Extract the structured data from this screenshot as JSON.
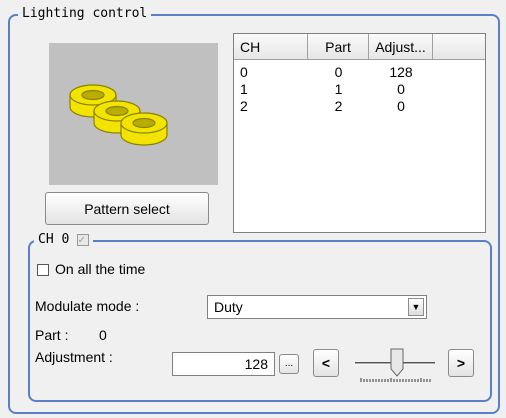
{
  "lighting_control": {
    "title": "Lighting control",
    "pattern_button": "Pattern select",
    "table": {
      "headers": [
        "CH",
        "Part",
        "Adjust..."
      ],
      "rows": [
        [
          "0",
          "0",
          "128"
        ],
        [
          "1",
          "1",
          "0"
        ],
        [
          "2",
          "2",
          "0"
        ]
      ]
    }
  },
  "channel": {
    "title": "CH 0",
    "enabled_checked": true,
    "on_all_the_time_label": "On all the time",
    "on_all_the_time_checked": false,
    "modulate_label": "Modulate mode :",
    "modulate_value": "Duty",
    "part_label": "Part :",
    "part_value": "0",
    "adjustment_label": "Adjustment :",
    "adjustment_value": "128",
    "ellipsis_button": "...",
    "decrease_button": "<",
    "increase_button": ">"
  },
  "colors": {
    "group_border": "#5a7fc7",
    "ring_yellow": "#f2e400",
    "preview_bg": "#c0c0c0"
  }
}
